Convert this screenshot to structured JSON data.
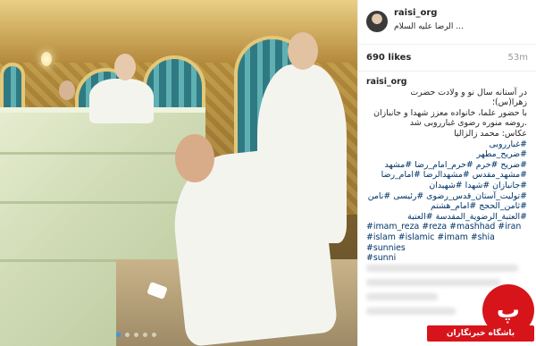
{
  "post": {
    "username": "raisi_org",
    "location": "... الرضا علیه السلام",
    "likes": "690 likes",
    "time": "53m"
  },
  "caption": {
    "username": "raisi_org",
    "line1": "در آستانه سال نو و ولادت حضرت",
    "line2": "زهرا(س)؛",
    "line3": "با حضور علما، خانواده معزز شهدا و جانبازان",
    "line4": ".روضه منوره رضوی غبارروبی شد",
    "line5": "عکاس: محمد زالزالیا",
    "tags": [
      "#غبارروبی",
      "#ضریح_مطهر",
      "#ضریح #حرم #حرم_امام_رضا #مشهد",
      "#مشهد_مقدس #مشهدالرضا #امام_رضا",
      "#جانبازان #شهدا #شهیدان",
      "#تولیت_آستان_قدس_رضوی #رئیسی #نامن",
      "#ثامن_الحجج #امام_هشتم",
      "#العتبة_الرضوية_المقدسة #العتبة"
    ],
    "tags_latin": [
      "#imam_reza #reza #mashhad #iran",
      "#islam #islamic #imam #shia #sunnies",
      "#sunni"
    ]
  },
  "watermark": {
    "glyph": "پ",
    "text": "باشگاه خبرنگاران"
  },
  "carousel": {
    "count": 5,
    "active_index": 0
  }
}
